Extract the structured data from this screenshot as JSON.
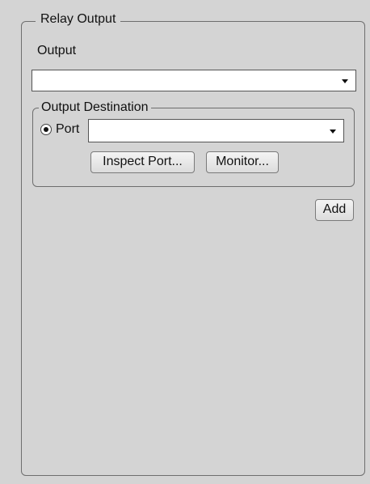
{
  "relay_output": {
    "title": "Relay Output",
    "output_label": "Output",
    "output_value": "",
    "destination": {
      "title": "Output Destination",
      "port_label": "Port",
      "port_selected": true,
      "port_value": "",
      "inspect_port_label": "Inspect Port...",
      "monitor_label": "Monitor..."
    },
    "add_label": "Add"
  }
}
